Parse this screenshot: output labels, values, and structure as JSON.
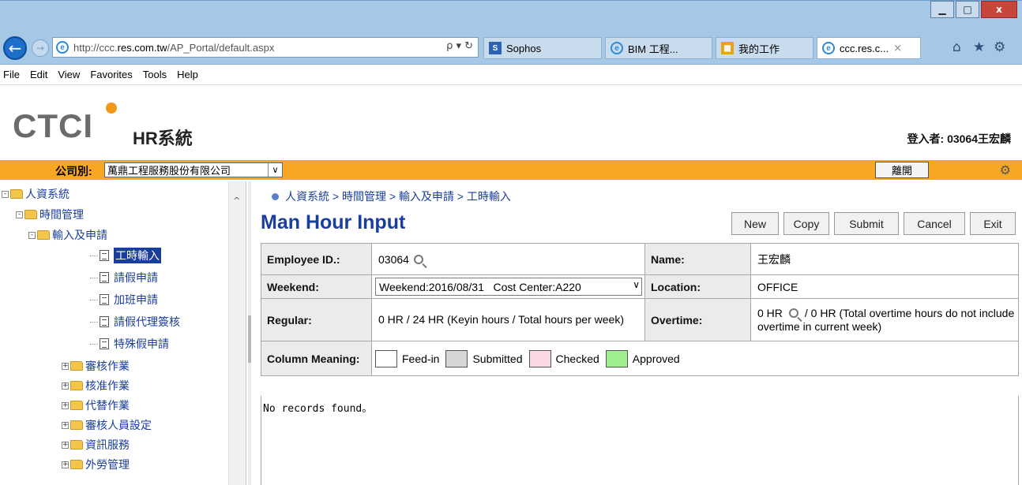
{
  "browser": {
    "url_prefix": "http://ccc.",
    "url_host": "res.com.tw",
    "url_path": "/AP_Portal/default.aspx",
    "addr_tools": "ρ ▾ ↻",
    "tabs": [
      {
        "label": "Sophos",
        "icon_text": "S",
        "icon_color": "#2b63b5"
      },
      {
        "label": "BIM 工程...",
        "icon_text": "e",
        "icon_color": "#2a8bd8"
      },
      {
        "label": "我的工作",
        "icon_text": "▦",
        "icon_color": "#e8a31c"
      },
      {
        "label": "ccc.res.c...",
        "icon_text": "e",
        "icon_color": "#2a8bd8"
      }
    ],
    "window_buttons": [
      "▁",
      "□",
      "x"
    ]
  },
  "menu": [
    "File",
    "Edit",
    "View",
    "Favorites",
    "Tools",
    "Help"
  ],
  "header": {
    "logo": "CTCI",
    "system_name": "HR系統",
    "login_label": "登入者: 03064王宏麟"
  },
  "company_bar": {
    "label": "公司別:",
    "selected": "萬鼎工程服務股份有限公司",
    "leave_button": "離開"
  },
  "tree": [
    {
      "label": "人資系統",
      "level": 0,
      "type": "folder",
      "sign": "-"
    },
    {
      "label": "時間管理",
      "level": 1,
      "type": "folder",
      "sign": "-"
    },
    {
      "label": "輸入及申請",
      "level": 2,
      "type": "folder",
      "sign": "-"
    },
    {
      "label": "工時輸入",
      "level": 3,
      "type": "doc",
      "selected": true
    },
    {
      "label": "請假申請",
      "level": 3,
      "type": "doc"
    },
    {
      "label": "加班申請",
      "level": 3,
      "type": "doc"
    },
    {
      "label": "請假代理簽核",
      "level": 3,
      "type": "doc"
    },
    {
      "label": "特殊假申請",
      "level": 3,
      "type": "doc"
    },
    {
      "label": "審核作業",
      "level": 1,
      "type": "folder",
      "sign": "+"
    },
    {
      "label": "核准作業",
      "level": 1,
      "type": "folder",
      "sign": "+"
    },
    {
      "label": "代替作業",
      "level": 1,
      "type": "folder",
      "sign": "+"
    },
    {
      "label": "審核人員設定",
      "level": 1,
      "type": "folder",
      "sign": "+"
    },
    {
      "label": "資訊服務",
      "level": 1,
      "type": "folder",
      "sign": "+"
    },
    {
      "label": "外勞管理",
      "level": 1,
      "type": "folder",
      "sign": "+"
    }
  ],
  "main": {
    "breadcrumb": "人資系統 > 時間管理 > 輸入及申請 > 工時輸入",
    "title": "Man Hour Input",
    "actions": [
      "New",
      "Copy",
      "Submit",
      "Cancel",
      "Exit"
    ],
    "form": {
      "employee_id_label": "Employee ID.:",
      "employee_id": "03064",
      "name_label": "Name:",
      "name": "王宏麟",
      "weekend_label": "Weekend:",
      "weekend_value": "Weekend:2016/08/31   Cost Center:A220",
      "location_label": "Location:",
      "location": "OFFICE",
      "regular_label": "Regular:",
      "regular_value": "0 HR  /  24 HR  (Keyin hours / Total hours per week)",
      "overtime_label": "Overtime:",
      "overtime_a": "0 HR",
      "overtime_b": "/  0 HR  (Total overtime hours do not include overtime in current week)",
      "column_label": "Column Meaning:",
      "legend": [
        {
          "label": "Feed-in",
          "color": "#ffffff"
        },
        {
          "label": "Submitted",
          "color": "#d6d6d6"
        },
        {
          "label": "Checked",
          "color": "#fbd9e4"
        },
        {
          "label": "Approved",
          "color": "#9fef8f"
        }
      ]
    },
    "no_records": "No records found。"
  }
}
